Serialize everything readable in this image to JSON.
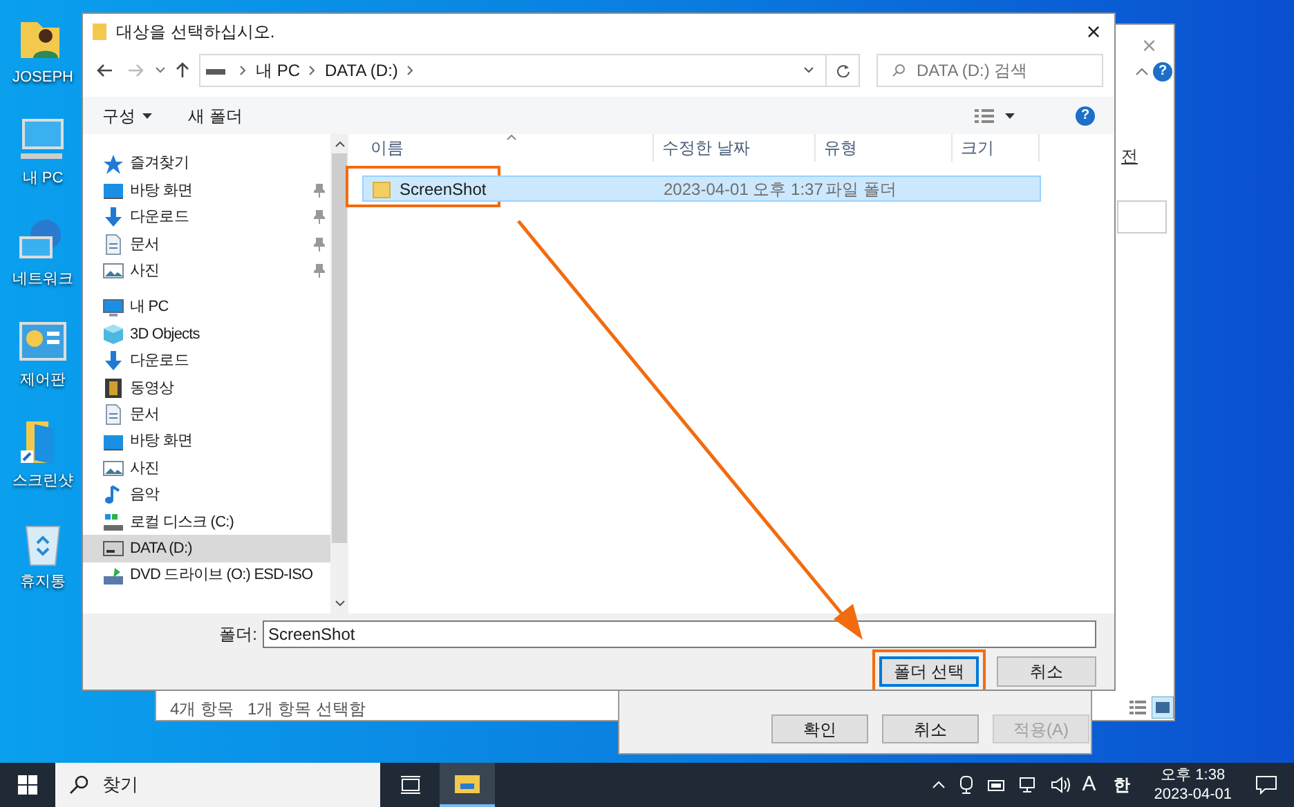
{
  "desktop_icons": [
    {
      "label": "JOSEPH",
      "kind": "user"
    },
    {
      "label": "내 PC",
      "kind": "pc"
    },
    {
      "label": "네트워크",
      "kind": "network"
    },
    {
      "label": "제어판",
      "kind": "control"
    },
    {
      "label": "스크린샷",
      "kind": "shortcut"
    },
    {
      "label": "휴지통",
      "kind": "recycle"
    }
  ],
  "background_window": {
    "close": "×",
    "help": "?",
    "partial_text": "전",
    "status_bar": [
      "4개 항목",
      "1개 항목 선택함"
    ]
  },
  "properties_dialog": {
    "buttons": [
      {
        "label": "확인",
        "disabled": false
      },
      {
        "label": "취소",
        "disabled": false
      },
      {
        "label": "적용(A)",
        "disabled": true
      }
    ]
  },
  "dialog": {
    "title": "대상을 선택하십시오.",
    "close": "×",
    "help": "?",
    "breadcrumb": [
      "내 PC",
      "DATA (D:)"
    ],
    "search": {
      "placeholder": "DATA (D:) 검색"
    },
    "toolbar": [
      {
        "label": "구성",
        "dropdown": true
      },
      {
        "label": "새 폴더",
        "dropdown": false
      }
    ],
    "nav": [
      {
        "label": "즐겨찾기",
        "kind": "star",
        "selected": false,
        "children": [
          {
            "label": "바탕 화면",
            "kind": "desktop",
            "pinned": true,
            "selected": false
          },
          {
            "label": "다운로드",
            "kind": "download",
            "pinned": true,
            "selected": false
          },
          {
            "label": "문서",
            "kind": "document",
            "pinned": true,
            "selected": false
          },
          {
            "label": "사진",
            "kind": "picture",
            "pinned": true,
            "selected": false
          }
        ]
      },
      {
        "label": "내 PC",
        "kind": "pc",
        "selected": false,
        "children": [
          {
            "label": "3D Objects",
            "kind": "cube",
            "pinned": false,
            "selected": false
          },
          {
            "label": "다운로드",
            "kind": "download",
            "pinned": false,
            "selected": false
          },
          {
            "label": "동영상",
            "kind": "video",
            "pinned": false,
            "selected": false
          },
          {
            "label": "문서",
            "kind": "document",
            "pinned": false,
            "selected": false
          },
          {
            "label": "바탕 화면",
            "kind": "desktop",
            "pinned": false,
            "selected": false
          },
          {
            "label": "사진",
            "kind": "picture",
            "pinned": false,
            "selected": false
          },
          {
            "label": "음악",
            "kind": "music",
            "pinned": false,
            "selected": false
          },
          {
            "label": "로컬 디스크 (C:)",
            "kind": "disk",
            "pinned": false,
            "selected": false
          },
          {
            "label": "DATA (D:)",
            "kind": "drive",
            "pinned": false,
            "selected": true
          },
          {
            "label": "DVD 드라이브 (O:) ESD-ISO",
            "kind": "dvd",
            "pinned": false,
            "selected": false
          }
        ]
      }
    ],
    "table": {
      "columns": [
        "이름",
        "수정한 날짜",
        "유형",
        "크기"
      ],
      "rows": [
        {
          "cells": [
            "ScreenShot",
            "2023-04-01 오후 1:37",
            "파일 폴더"
          ],
          "selected": true,
          "highlighted": true
        }
      ]
    },
    "folder_field": {
      "label": "폴더:",
      "value": "ScreenShot"
    },
    "buttons": [
      {
        "label": "폴더 선택",
        "default": true,
        "highlighted": true
      },
      {
        "label": "취소",
        "default": false,
        "highlighted": false
      }
    ]
  },
  "taskbar": {
    "search_placeholder": "찾기",
    "apps": [
      {
        "kind": "task-view",
        "active": false
      },
      {
        "kind": "explorer",
        "active": true
      }
    ],
    "ime": "A",
    "language": "한",
    "time": "오후 1:38",
    "date": "2023-04-01"
  }
}
